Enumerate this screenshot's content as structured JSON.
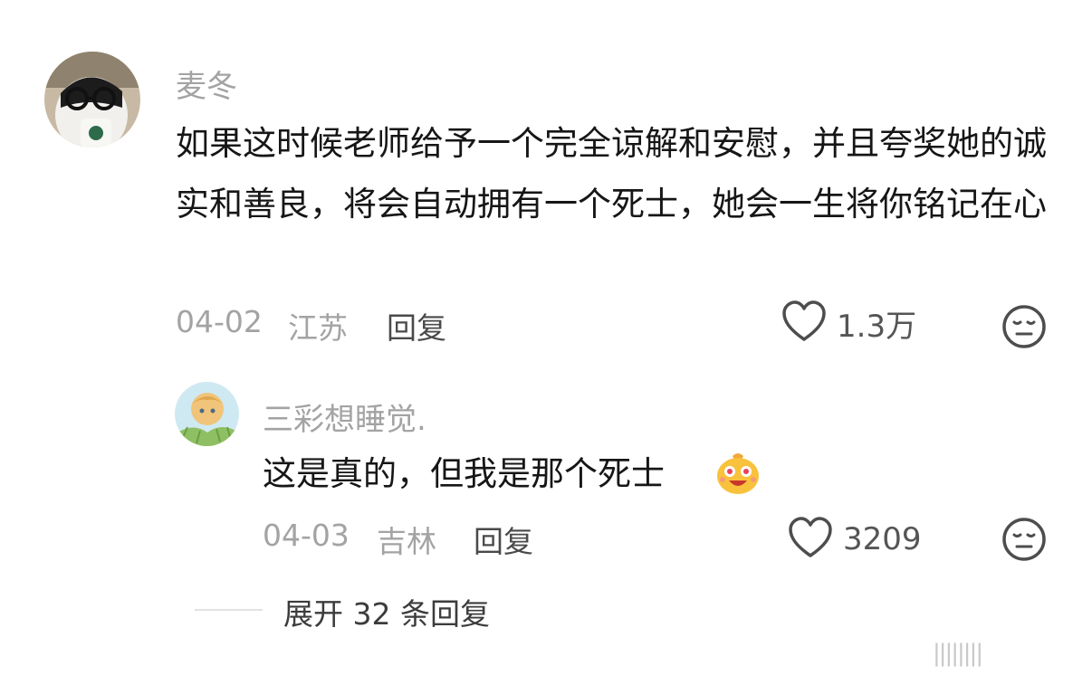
{
  "comment": {
    "username": "麦冬",
    "text": "如果这时候老师给予一个完全谅解和安慰，并且夸奖她的诚实和善良，将会自动拥有一个死士，她会一生将你铭记在心",
    "date": "04-02",
    "location": "江苏",
    "reply_label": "回复",
    "like_count": "1.3万"
  },
  "reply": {
    "username": "三彩想睡觉.",
    "text": "这是真的，但我是那个死士",
    "date": "04-03",
    "location": "吉林",
    "reply_label": "回复",
    "like_count": "3209"
  },
  "expand": {
    "label": "展开 32 条回复"
  },
  "watermark": "||||||||"
}
